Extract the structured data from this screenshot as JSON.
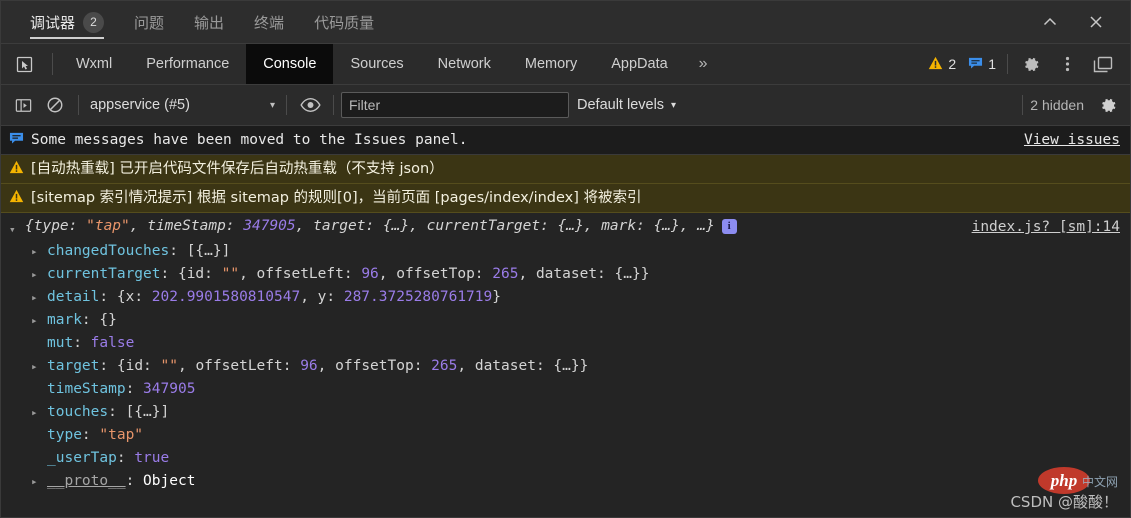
{
  "window": {
    "panel_tabs": [
      {
        "label": "调试器",
        "badge": "2",
        "active": true
      },
      {
        "label": "问题",
        "badge": "",
        "active": false
      },
      {
        "label": "输出",
        "badge": "",
        "active": false
      },
      {
        "label": "终端",
        "badge": "",
        "active": false
      },
      {
        "label": "代码质量",
        "badge": "",
        "active": false
      }
    ],
    "collapse_icon": "chevron-up-icon",
    "close_icon": "close-icon"
  },
  "devtools": {
    "inspect_icon": "inspect-element-icon",
    "tabs": [
      {
        "label": "Wxml",
        "active": false
      },
      {
        "label": "Performance",
        "active": false
      },
      {
        "label": "Console",
        "active": true
      },
      {
        "label": "Sources",
        "active": false
      },
      {
        "label": "Network",
        "active": false
      },
      {
        "label": "Memory",
        "active": false
      },
      {
        "label": "AppData",
        "active": false
      }
    ],
    "more_tabs_label": "»",
    "warning_count": "2",
    "message_count": "1",
    "settings_icon": "gear-icon",
    "more_icon": "kebab-menu-icon",
    "dock_icon": "dock-panel-icon"
  },
  "console_toolbar": {
    "sidebar_icon": "show-console-sidebar-icon",
    "clear_icon": "clear-console-icon",
    "context": "appservice (#5)",
    "context_caret": "▾",
    "eye_icon": "live-expression-eye-icon",
    "filter_placeholder": "Filter",
    "filter_value": "",
    "levels_label": "Default levels",
    "levels_caret": "▾",
    "hidden_label": "2 hidden",
    "settings_icon": "gear-icon"
  },
  "messages": {
    "issues_bar": {
      "icon": "issue-message-icon",
      "text": "Some messages have been moved to the Issues panel.",
      "action": "View issues"
    },
    "warnings": [
      {
        "icon": "warning-triangle-icon",
        "text": "[自动热重载] 已开启代码文件保存后自动热重载（不支持 json）"
      },
      {
        "icon": "warning-triangle-icon",
        "text": "[sitemap 索引情况提示] 根据 sitemap 的规则[0]，当前页面 [pages/index/index] 将被索引"
      }
    ]
  },
  "logged_object": {
    "disclosure": "▾",
    "preview_parts": [
      {
        "t": "{type: ",
        "c": "p"
      },
      {
        "t": "\"tap\"",
        "c": "str"
      },
      {
        "t": ", timeStamp: ",
        "c": "p"
      },
      {
        "t": "347905",
        "c": "num"
      },
      {
        "t": ", target: {…}, currentTarget: {…}, mark: {…}, …}",
        "c": "p"
      }
    ],
    "info_badge": "i",
    "source_link": "index.js? [sm]:14",
    "properties": [
      {
        "expandable": true,
        "key": "changedTouches",
        "parts": [
          {
            "t": "[{…}]",
            "c": "obj-val"
          }
        ]
      },
      {
        "expandable": true,
        "key": "currentTarget",
        "parts": [
          {
            "t": "{id: ",
            "c": "p"
          },
          {
            "t": "\"\"",
            "c": "str"
          },
          {
            "t": ", offsetLeft: ",
            "c": "p"
          },
          {
            "t": "96",
            "c": "num"
          },
          {
            "t": ", offsetTop: ",
            "c": "p"
          },
          {
            "t": "265",
            "c": "num"
          },
          {
            "t": ", dataset: {…}}",
            "c": "p"
          }
        ]
      },
      {
        "expandable": true,
        "key": "detail",
        "parts": [
          {
            "t": "{x: ",
            "c": "p"
          },
          {
            "t": "202.9901580810547",
            "c": "num"
          },
          {
            "t": ", y: ",
            "c": "p"
          },
          {
            "t": "287.3725280761719",
            "c": "num"
          },
          {
            "t": "}",
            "c": "p"
          }
        ]
      },
      {
        "expandable": true,
        "key": "mark",
        "parts": [
          {
            "t": "{}",
            "c": "obj-val"
          }
        ]
      },
      {
        "expandable": false,
        "key": "mut",
        "parts": [
          {
            "t": "false",
            "c": "bool"
          }
        ]
      },
      {
        "expandable": true,
        "key": "target",
        "parts": [
          {
            "t": "{id: ",
            "c": "p"
          },
          {
            "t": "\"\"",
            "c": "str"
          },
          {
            "t": ", offsetLeft: ",
            "c": "p"
          },
          {
            "t": "96",
            "c": "num"
          },
          {
            "t": ", offsetTop: ",
            "c": "p"
          },
          {
            "t": "265",
            "c": "num"
          },
          {
            "t": ", dataset: {…}}",
            "c": "p"
          }
        ]
      },
      {
        "expandable": false,
        "key": "timeStamp",
        "parts": [
          {
            "t": "347905",
            "c": "num"
          }
        ]
      },
      {
        "expandable": true,
        "key": "touches",
        "parts": [
          {
            "t": "[{…}]",
            "c": "obj-val"
          }
        ]
      },
      {
        "expandable": false,
        "key": "type",
        "parts": [
          {
            "t": "\"tap\"",
            "c": "str"
          }
        ]
      },
      {
        "expandable": false,
        "key": "_userTap",
        "parts": [
          {
            "t": "true",
            "c": "bool"
          }
        ]
      },
      {
        "expandable": true,
        "key": "__proto__",
        "key_class": "proto",
        "parts": [
          {
            "t": "Object",
            "c": "cls"
          }
        ]
      }
    ]
  },
  "watermark": {
    "text": "CSDN @酸酸！",
    "logo": "php",
    "sub": "中文网"
  }
}
